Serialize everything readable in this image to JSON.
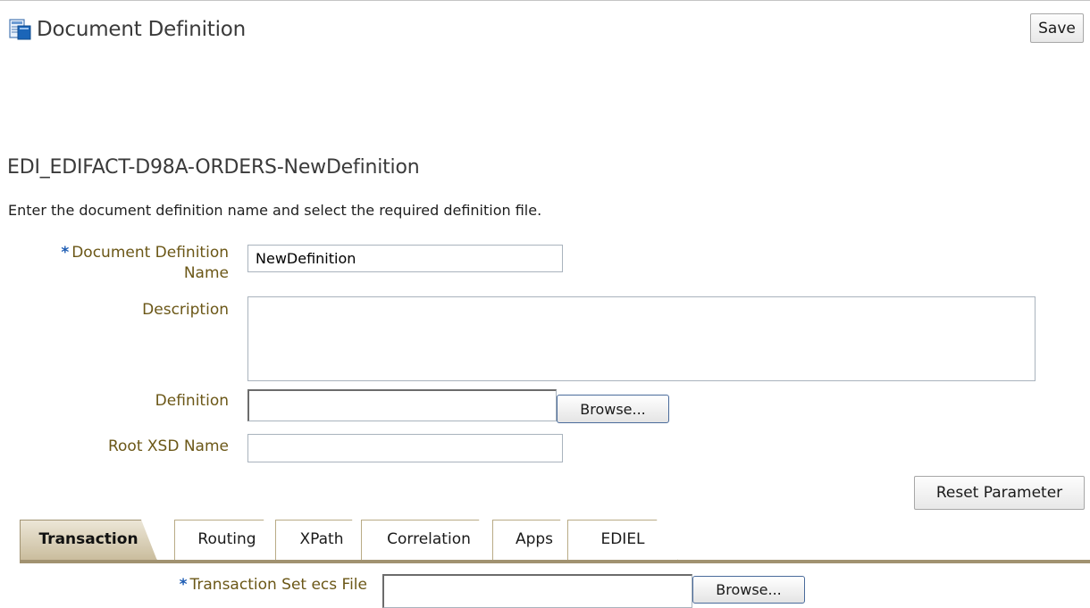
{
  "header": {
    "title": "Document Definition",
    "save_label": "Save",
    "icon": "document-definition-icon"
  },
  "main": {
    "subtitle": "EDI_EDIFACT-D98A-ORDERS-NewDefinition",
    "instruction": "Enter the document definition name and select the required definition file.",
    "required_marker": "*",
    "fields": {
      "doc_name": {
        "label_line1": "Document Definition",
        "label_line2": "Name",
        "value": "NewDefinition"
      },
      "description": {
        "label": "Description",
        "value": ""
      },
      "definition": {
        "label": "Definition",
        "value": "",
        "browse_label": "Browse..."
      },
      "root_xsd": {
        "label": "Root XSD Name",
        "value": ""
      }
    },
    "reset_label": "Reset Parameter"
  },
  "tabs": {
    "active_index": 0,
    "items": [
      {
        "label": "Transaction"
      },
      {
        "label": "Routing"
      },
      {
        "label": "XPath"
      },
      {
        "label": "Correlation"
      },
      {
        "label": "Apps"
      },
      {
        "label": "EDIEL"
      }
    ]
  },
  "transaction": {
    "ecs_label": "Transaction Set ecs File",
    "ecs_value": "",
    "browse_label": "Browse..."
  },
  "colors": {
    "label_text": "#6b5717",
    "required_marker": "#1c5bb3",
    "tab_active": "#c9bc9c",
    "tab_line": "#a19270"
  }
}
